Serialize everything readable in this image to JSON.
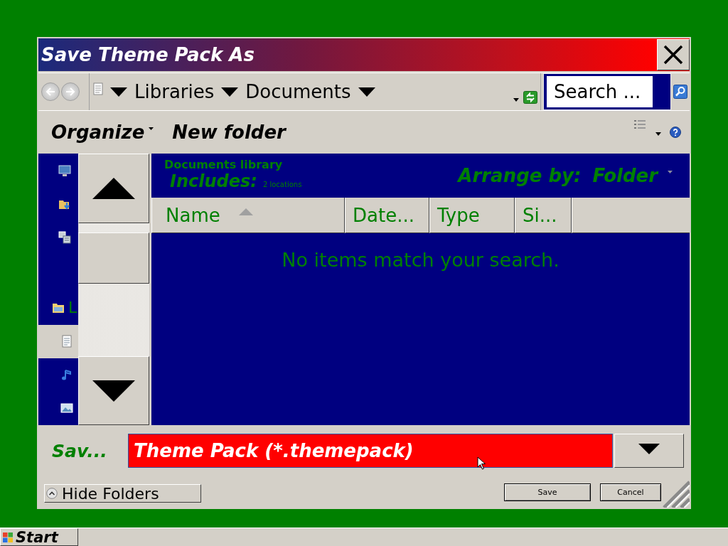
{
  "window": {
    "title": "Save Theme Pack As"
  },
  "address_bar": {
    "crumbs": [
      "Libraries",
      "Documents"
    ]
  },
  "search": {
    "placeholder": "Search ..."
  },
  "toolbar": {
    "buttons": [
      {
        "label": "Organize",
        "menu": true
      },
      {
        "label": "New folder",
        "menu": false
      }
    ]
  },
  "nav_pane": {
    "items": [
      {
        "kind": "desktop",
        "selected": false
      },
      {
        "kind": "downloads",
        "selected": false
      },
      {
        "kind": "recent",
        "selected": false
      },
      {
        "kind": "library",
        "label": "L",
        "selected": false,
        "children": [
          {
            "kind": "documents",
            "selected": true
          },
          {
            "kind": "music",
            "selected": false
          },
          {
            "kind": "pictures",
            "selected": false
          }
        ]
      }
    ]
  },
  "library": {
    "title": "Documents library",
    "includes": "Includes:",
    "locations": "2 locations",
    "arrange_label": "Arrange by:",
    "arrange_value": "Folder"
  },
  "columns": [
    {
      "label": "Name",
      "sorted": true
    },
    {
      "label": "Date...",
      "sorted": false
    },
    {
      "label": "Type",
      "sorted": false
    },
    {
      "label": "Si...",
      "sorted": false
    }
  ],
  "empty_message": "No items match your search.",
  "save_type": {
    "label": "Sav...",
    "value": "Theme Pack (*.themepack)"
  },
  "hide_folders": "Hide Folders",
  "buttons": [
    "Save",
    "Cancel"
  ],
  "taskbar": {
    "start": "Start"
  }
}
